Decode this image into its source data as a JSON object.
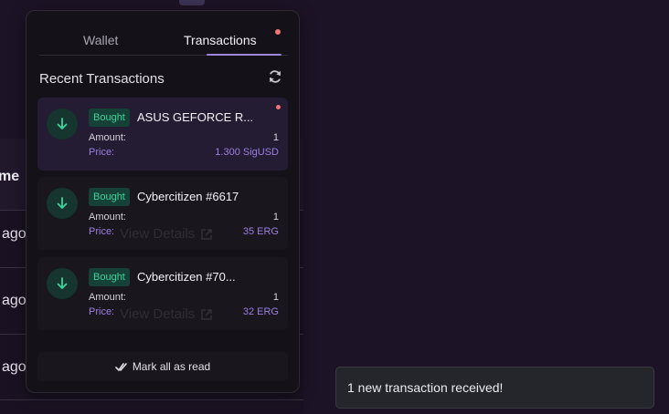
{
  "background": {
    "column_header": "me",
    "row_times": [
      "ago",
      "ago",
      "ago"
    ]
  },
  "tabs": [
    {
      "label": "Wallet",
      "active": false
    },
    {
      "label": "Transactions",
      "active": true,
      "unread": true
    }
  ],
  "section_title": "Recent Transactions",
  "transactions": [
    {
      "badge": "Bought",
      "title": "ASUS GEFORCE R...",
      "amount_label": "Amount:",
      "amount": "1",
      "price_label": "Price:",
      "price": "1.300 SigUSD",
      "unread": true,
      "link_text": ""
    },
    {
      "badge": "Bought",
      "title": "Cybercitizen #6617",
      "amount_label": "Amount:",
      "amount": "1",
      "price_label": "Price:",
      "price": "35 ERG",
      "unread": false,
      "link_text": "View Details"
    },
    {
      "badge": "Bought",
      "title": "Cybercitizen #70...",
      "amount_label": "Amount:",
      "amount": "1",
      "price_label": "Price:",
      "price": "32 ERG",
      "unread": false,
      "link_text": "View Details"
    }
  ],
  "mark_all_label": "Mark all as read",
  "toast": {
    "message": "1 new transaction received!"
  },
  "colors": {
    "accent": "#9a87d8",
    "badge_green": "#3fd39a",
    "price_purple": "#9d7ee0",
    "unread_dot": "#f07575"
  }
}
